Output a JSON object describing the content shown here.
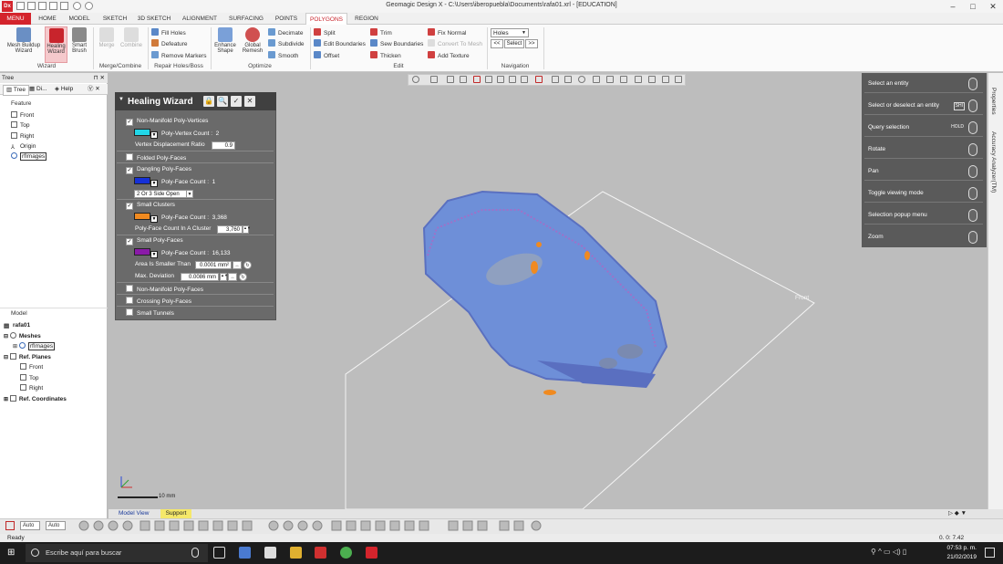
{
  "app": {
    "logo": "Dx",
    "title": "Geomagic Design X - C:\\Users\\iberopuebla\\Documents\\rafa01.xrl - [EDUCATION]"
  },
  "tabs": [
    "MENU",
    "HOME",
    "MODEL",
    "SKETCH",
    "3D SKETCH",
    "ALIGNMENT",
    "SURFACING",
    "POINTS",
    "POLYGONS",
    "REGION"
  ],
  "ribbon": {
    "wizard": {
      "b1": "Mesh Buildup",
      "b1b": "Wizard",
      "b2": "Healing",
      "b2b": "Wizard",
      "b3": "Smart",
      "b3b": "Brush",
      "label": "Wizard"
    },
    "merge": {
      "b1": "Merge",
      "b2": "Combine",
      "label": "Merge/Combine"
    },
    "repair": {
      "i1": "Fill Holes",
      "i2": "Defeature",
      "i3": "Remove Markers",
      "label": "Repair Holes/Boss"
    },
    "optimize": {
      "b1": "Enhance",
      "b1b": "Shape",
      "b2": "Global",
      "b2b": "Remesh",
      "i1": "Decimate",
      "i2": "Subdivide",
      "i3": "Smooth",
      "label": "Optimize"
    },
    "edit": {
      "i1": "Split",
      "i2": "Edit Boundaries",
      "i3": "Offset",
      "i4": "Trim",
      "i5": "Sew Boundaries",
      "i6": "Thicken",
      "i7": "Fix Normal",
      "i8": "Convert To Mesh",
      "i9": "Add Texture",
      "label": "Edit"
    },
    "nav": {
      "select_value": "Holes",
      "prev": "<<",
      "btn": "Select",
      "next": ">>",
      "label": "Navigation"
    }
  },
  "left": {
    "header": "Tree",
    "tabs": [
      "Tree",
      "Di...",
      "Help"
    ],
    "feature_title": "Feature",
    "feature": [
      "Front",
      "Top",
      "Right",
      "Origin",
      "rfImages"
    ],
    "model_title": "Model",
    "model": [
      "rafa01",
      "Meshes",
      "rfImages",
      "Ref. Planes",
      "Front",
      "Top",
      "Right",
      "Ref. Coordinates"
    ]
  },
  "healing": {
    "title": "Healing Wizard",
    "s1": "Non-Manifold Poly-Vertices",
    "s1_count_label": "Poly-Vertex Count :",
    "s1_count": "2",
    "s1_ratio_label": "Vertex Displacement Ratio",
    "s1_ratio": "0.9",
    "s2": "Folded Poly-Faces",
    "s3": "Dangling Poly-Faces",
    "s3_count_label": "Poly-Face Count :",
    "s3_count": "1",
    "s3_option": "2 Or 3 Side Open",
    "s4": "Small Clusters",
    "s4_count_label": "Poly-Face Count :",
    "s4_count": "3,368",
    "s4_cluster_label": "Poly-Face Count In A Cluster",
    "s4_cluster": "3,760",
    "s5": "Small Poly-Faces",
    "s5_count_label": "Poly-Face Count :",
    "s5_count": "16,133",
    "s5_area_label": "Area Is Smaller Than",
    "s5_area": "0.0001 mm²",
    "s5_dev_label": "Max. Deviation",
    "s5_dev": "0.0086 mm",
    "s6": "Non-Manifold Poly-Faces",
    "s7": "Crossing Poly-Faces",
    "s8": "Small Tunnels",
    "colors": {
      "c1": "#22d6e8",
      "c3": "#1530d8",
      "c4": "#f08a20",
      "c5": "#8a1aa8"
    }
  },
  "mouse_guide": [
    "Select an entity",
    "Select or deselect an entity",
    "Query selection",
    "Rotate",
    "Pan",
    "Toggle viewing mode",
    "Selection popup menu",
    "Zoom"
  ],
  "mouse_keys": {
    "shift": "SHI",
    "hold": "HOLD"
  },
  "side_tabs": [
    "Properties",
    "Accuracy Analyzer(TM)"
  ],
  "viewport": {
    "plane_label": "Front",
    "scale": "10 mm"
  },
  "bottom": {
    "tab1": "Model View",
    "tab2": "Support",
    "auto1": "Auto",
    "auto2": "Auto"
  },
  "status": {
    "text": "Ready",
    "time": "0. 0: 7.42"
  },
  "taskbar": {
    "search": "Escribe aquí para buscar",
    "time": "07:53 p. m.",
    "date": "21/02/2019"
  }
}
